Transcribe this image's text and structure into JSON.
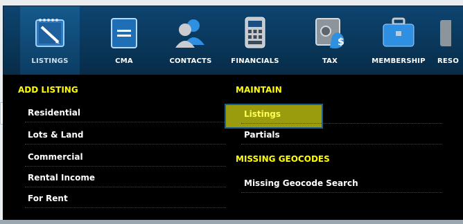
{
  "nav": {
    "items": [
      {
        "label": "LISTINGS",
        "icon": "notepad-pencil-icon"
      },
      {
        "label": "CMA",
        "icon": "document-icon"
      },
      {
        "label": "CONTACTS",
        "icon": "people-icon"
      },
      {
        "label": "FINANCIALS",
        "icon": "calculator-icon"
      },
      {
        "label": "TAX",
        "icon": "safe-dollar-icon"
      },
      {
        "label": "MEMBERSHIP",
        "icon": "briefcase-icon"
      },
      {
        "label": "RESO",
        "icon": "resources-icon"
      }
    ]
  },
  "menu": {
    "add_listing": {
      "title": "ADD LISTING",
      "links": [
        "Residential",
        "Lots & Land",
        "Commercial",
        "Rental Income",
        "For Rent"
      ]
    },
    "maintain": {
      "title": "MAINTAIN",
      "links": [
        "Listings",
        "Partials"
      ]
    },
    "missing_geocodes": {
      "title": "MISSING GEOCODES",
      "links": [
        "Missing Geocode Search"
      ]
    }
  },
  "colors": {
    "nav_bg": "#0a3a5e",
    "menu_bg": "#000000",
    "section_title": "#ffff00",
    "hover_fill": "#9b9b0e"
  }
}
